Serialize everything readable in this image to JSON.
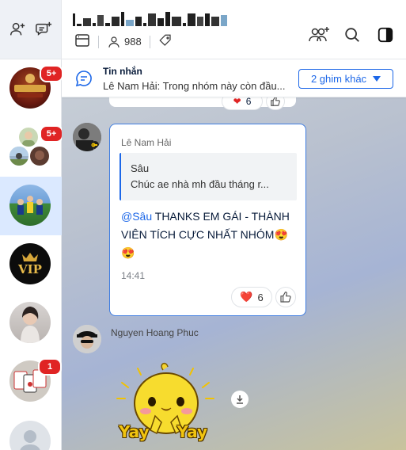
{
  "sidebar": {
    "top_icons": [
      "add-friend-icon",
      "create-group-icon"
    ],
    "conversations": [
      {
        "name": "conversation-1",
        "badge": "5+",
        "avatar": "brown-logo"
      },
      {
        "name": "conversation-2",
        "badge": "5+",
        "avatar": "group-avatars"
      },
      {
        "name": "conversation-3",
        "badge": "",
        "avatar": "football-team",
        "active": true
      },
      {
        "name": "conversation-4",
        "badge": "",
        "avatar": "vip-logo"
      },
      {
        "name": "conversation-5",
        "badge": "",
        "avatar": "person-photo"
      },
      {
        "name": "conversation-6",
        "badge": "1",
        "avatar": "cards-photo"
      },
      {
        "name": "conversation-7",
        "badge": "",
        "avatar": "default-avatar"
      }
    ]
  },
  "header": {
    "member_count": "988",
    "icons": [
      "add-member-icon",
      "search-icon",
      "toggle-panel-icon"
    ]
  },
  "pinned": {
    "title": "Tin nhắn",
    "preview": "Lê Nam Hải: Trong nhóm này còn đầu...",
    "more_label": "2 ghim khác"
  },
  "messages": {
    "prev_reaction_count": "6",
    "main": {
      "sender": "Lê Nam Hải",
      "quote_author": "Sâu",
      "quote_text": "Chúc ae nhà mh đầu tháng r...",
      "mention": "@Sâu",
      "text": " THANKS EM GÁI - THÀNH VIÊN TÍCH CỰC NHẤT NHÓM",
      "emoji": "😍😍",
      "time": "14:41",
      "reaction_emoji": "❤️",
      "reaction_count": "6"
    },
    "second": {
      "sender": "Nguyen Hoang Phuc",
      "sticker_text": "Yay Yay"
    }
  },
  "colors": {
    "accent": "#1c67e8",
    "badge": "#e02424",
    "active_bg": "#dbe9ff"
  }
}
